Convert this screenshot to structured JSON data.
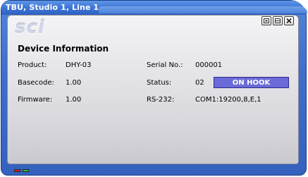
{
  "window": {
    "title": "TBU, Studio 1, Line 1",
    "logo_text": "sci"
  },
  "controls": {
    "restore": "restore-icon",
    "minimize": "minimize-icon",
    "close": "close-icon"
  },
  "device_info": {
    "heading": "Device Information",
    "product_label": "Product:",
    "product_value": "DHY-03",
    "basecode_label": "Basecode:",
    "basecode_value": "1.00",
    "firmware_label": "Firmware:",
    "firmware_value": "1.00",
    "serial_label": "Serial No.:",
    "serial_value": "000001",
    "status_label": "Status:",
    "status_code": "02",
    "status_text": "ON HOOK",
    "rs232_label": "RS-232:",
    "rs232_value": "COM1:19200,8,E,1"
  },
  "indicators": [
    {
      "name": "red-led",
      "color": "#e02020"
    },
    {
      "name": "green-led",
      "color": "#30c030"
    }
  ],
  "colors": {
    "title_blue": "#3c72d4",
    "status_badge": "#6a6ad8"
  }
}
